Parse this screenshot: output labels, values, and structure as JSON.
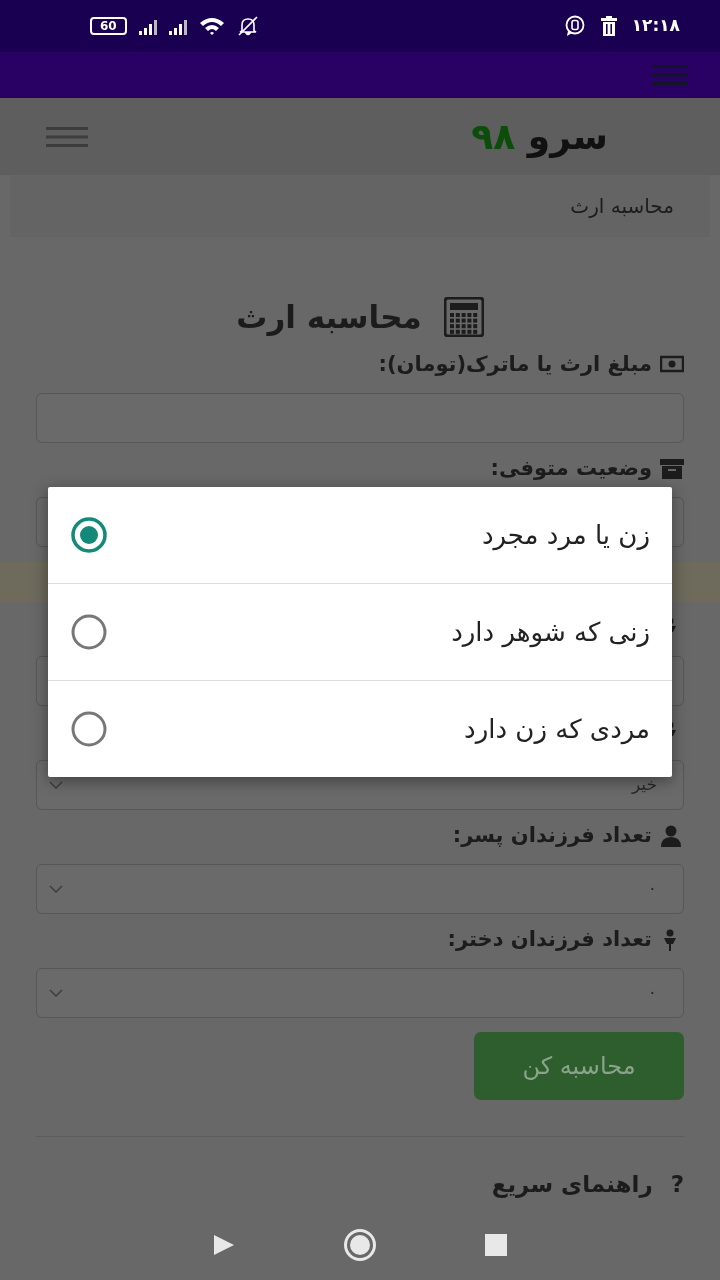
{
  "status_bar": {
    "time": "۱۲:۱۸",
    "battery": "60"
  },
  "header": {
    "logo_text": "سرو",
    "logo_number": "۹۸"
  },
  "breadcrumb": "محاسبه ارث",
  "title": "محاسبه ارث",
  "fields": [
    {
      "kind": "input",
      "label": "مبلغ ارث یا ماترک(تومان):"
    },
    {
      "kind": "select",
      "label": "وضعیت متوفی:"
    },
    {
      "kind": "alert"
    },
    {
      "kind": "select"
    },
    {
      "kind": "select",
      "value": "خیر"
    },
    {
      "kind": "select",
      "label": "تعداد فرزندان پسر:",
      "value": "۰"
    },
    {
      "kind": "select",
      "label": "تعداد فرزندان دختر:",
      "value": "۰"
    }
  ],
  "submit": "محاسبه کن",
  "help": {
    "mark": "?",
    "title": "راهنمای سریع"
  },
  "dialog": {
    "options": [
      {
        "label": "زن یا مرد مجرد",
        "selected": true
      },
      {
        "label": "زنی که شوهر دارد",
        "selected": false
      },
      {
        "label": "مردی که زن دارد",
        "selected": false
      }
    ]
  }
}
